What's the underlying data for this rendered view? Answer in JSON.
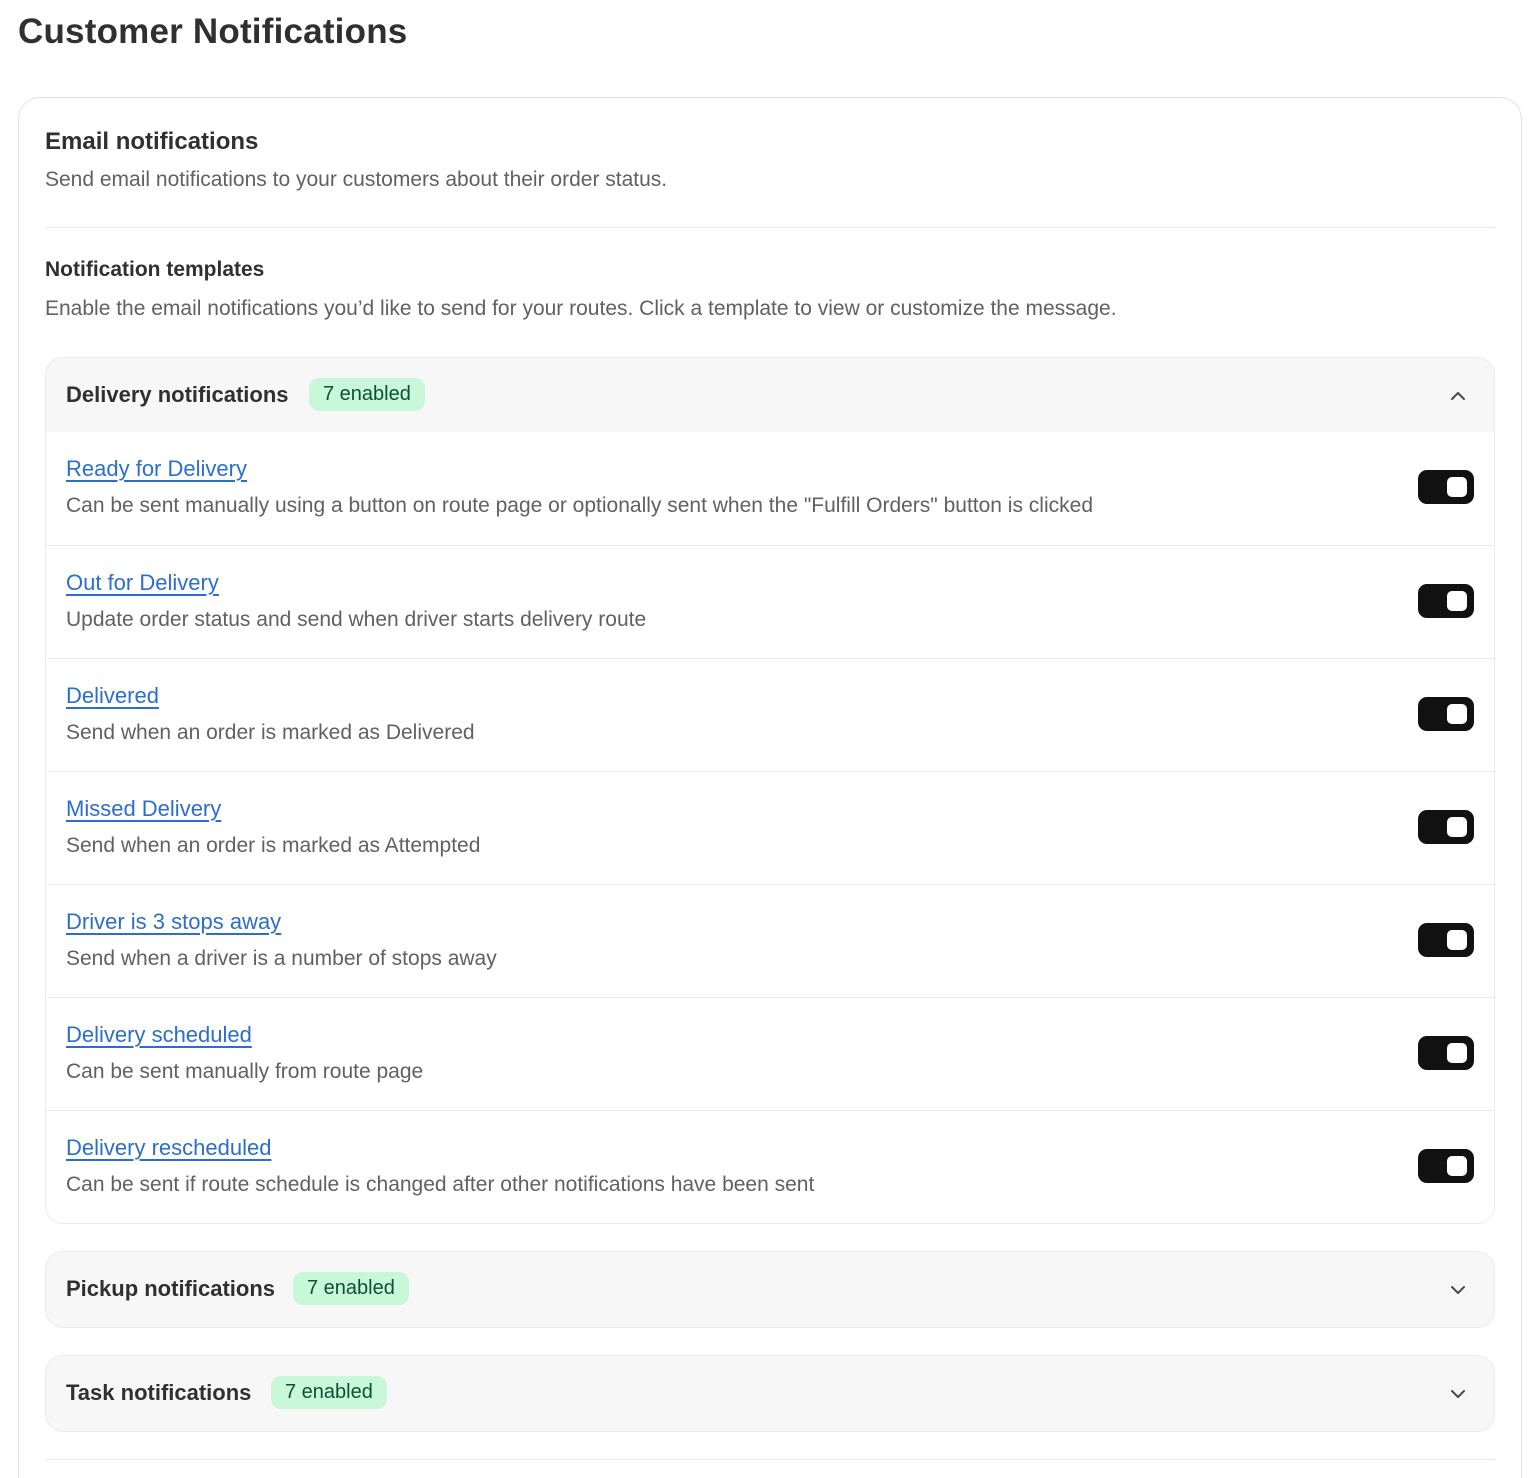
{
  "page": {
    "title": "Customer Notifications"
  },
  "email": {
    "title": "Email notifications",
    "description": "Send email notifications to your customers about their order status."
  },
  "templates": {
    "title": "Notification templates",
    "description": "Enable the email notifications you’d like to send for your routes. Click a template to view or customize the message."
  },
  "delivery": {
    "title": "Delivery notifications",
    "badge": "7 enabled",
    "expanded": true,
    "items": [
      {
        "label": "Ready for Delivery",
        "description": "Can be sent manually using a button on route page or optionally sent when the \"Fulfill Orders\" button is clicked",
        "enabled": true
      },
      {
        "label": "Out for Delivery",
        "description": "Update order status and send when driver starts delivery route",
        "enabled": true
      },
      {
        "label": "Delivered",
        "description": "Send when an order is marked as Delivered",
        "enabled": true
      },
      {
        "label": "Missed Delivery",
        "description": "Send when an order is marked as Attempted",
        "enabled": true
      },
      {
        "label": "Driver is 3 stops away",
        "description": "Send when a driver is a number of stops away",
        "enabled": true
      },
      {
        "label": "Delivery scheduled",
        "description": "Can be sent manually from route page",
        "enabled": true
      },
      {
        "label": "Delivery rescheduled",
        "description": "Can be sent if route schedule is changed after other notifications have been sent",
        "enabled": true
      }
    ]
  },
  "pickup": {
    "title": "Pickup notifications",
    "badge": "7 enabled",
    "expanded": false
  },
  "task": {
    "title": "Task notifications",
    "badge": "7 enabled",
    "expanded": false
  },
  "icons": {
    "collapse": "chevron-up-icon",
    "expand": "chevron-down-icon"
  },
  "colors": {
    "link": "#2c6ecb",
    "badge_bg": "#c9f7d9",
    "badge_text": "#0c5132",
    "toggle_on": "#111111"
  }
}
